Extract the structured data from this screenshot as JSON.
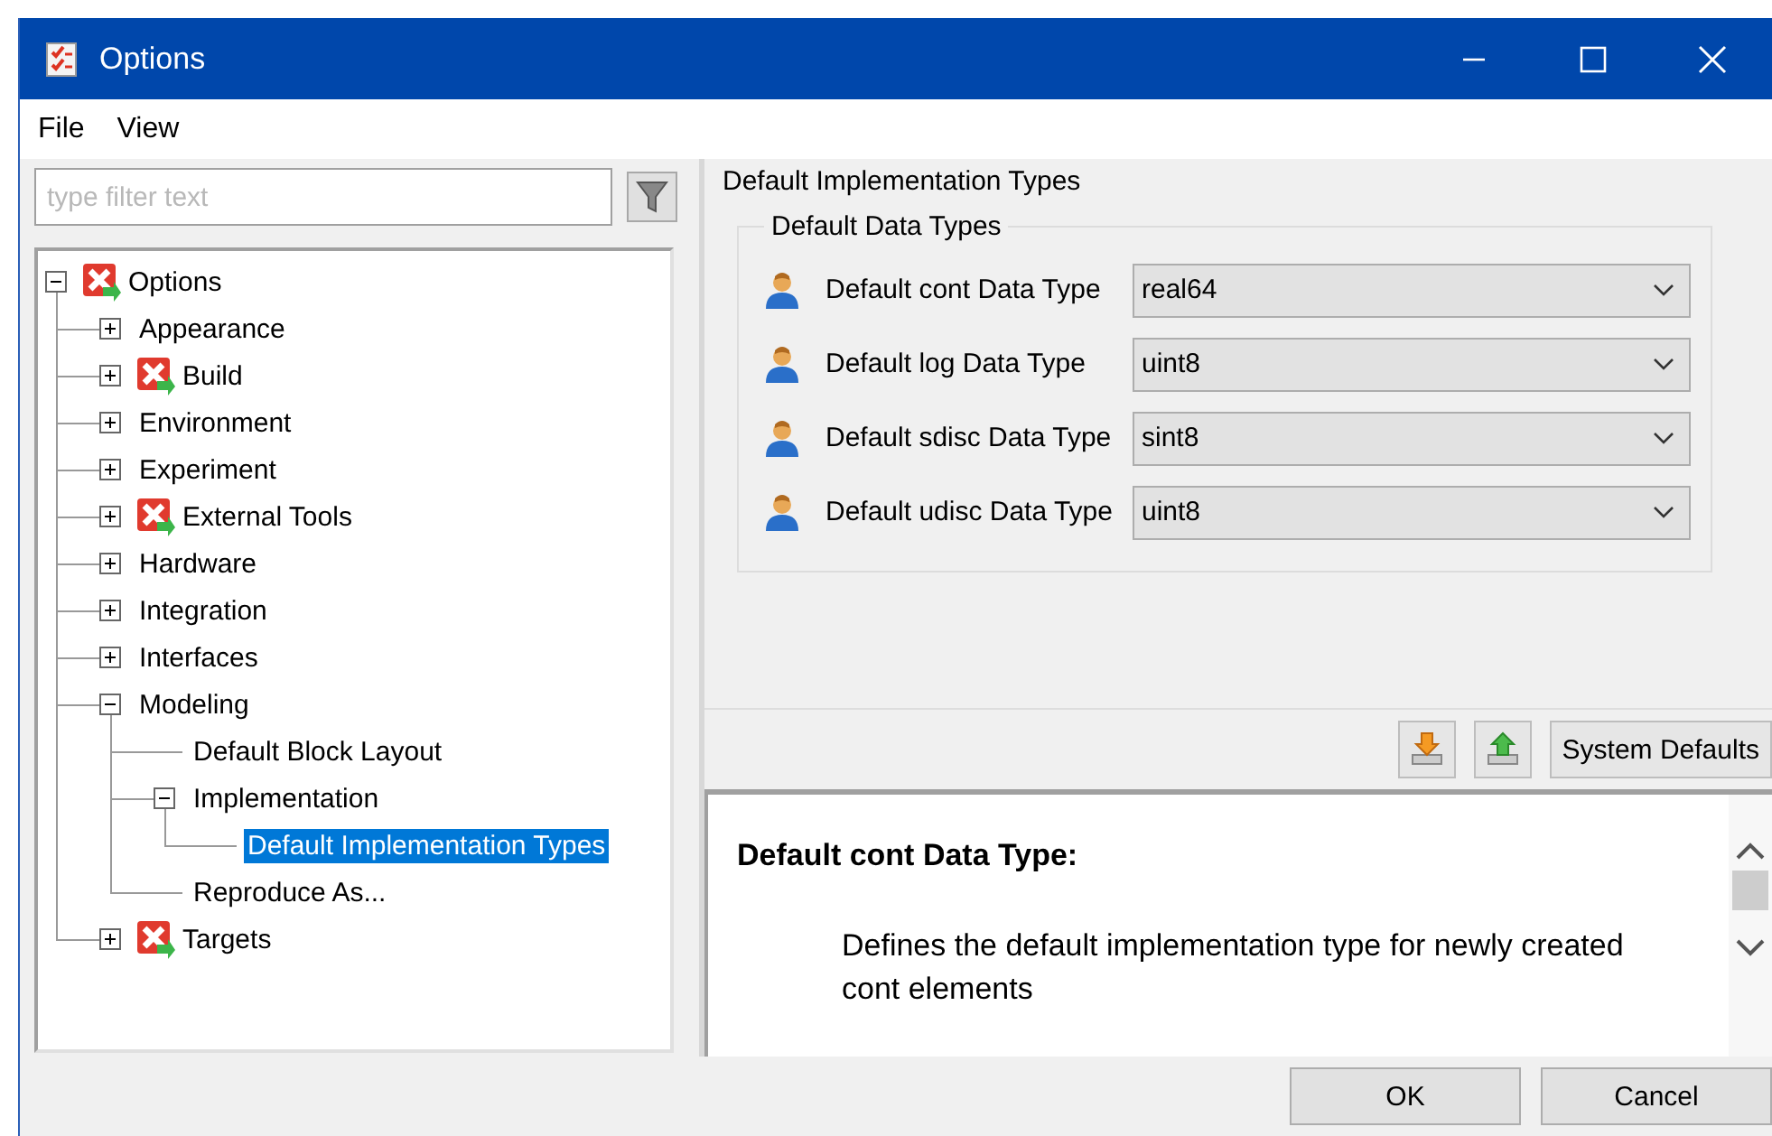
{
  "window": {
    "title": "Options"
  },
  "menu": [
    {
      "label": "File"
    },
    {
      "label": "View"
    }
  ],
  "filter": {
    "placeholder": "type filter text"
  },
  "tree": [
    {
      "label": "Options",
      "marked": true,
      "expanded": true,
      "selected": false,
      "children": [
        {
          "label": "Appearance",
          "marked": false,
          "expanded": false,
          "selected": false
        },
        {
          "label": "Build",
          "marked": true,
          "expanded": false,
          "selected": false
        },
        {
          "label": "Environment",
          "marked": false,
          "expanded": false,
          "selected": false
        },
        {
          "label": "Experiment",
          "marked": false,
          "expanded": false,
          "selected": false
        },
        {
          "label": "External Tools",
          "marked": true,
          "expanded": false,
          "selected": false
        },
        {
          "label": "Hardware",
          "marked": false,
          "expanded": false,
          "selected": false
        },
        {
          "label": "Integration",
          "marked": false,
          "expanded": false,
          "selected": false
        },
        {
          "label": "Interfaces",
          "marked": false,
          "expanded": false,
          "selected": false
        },
        {
          "label": "Modeling",
          "marked": false,
          "expanded": true,
          "selected": false,
          "children": [
            {
              "label": "Default Block Layout",
              "marked": false,
              "selected": false
            },
            {
              "label": "Implementation",
              "marked": false,
              "expanded": true,
              "selected": false,
              "children": [
                {
                  "label": "Default Implementation Types",
                  "marked": false,
                  "selected": true
                }
              ]
            },
            {
              "label": "Reproduce As...",
              "marked": false,
              "selected": false
            }
          ]
        },
        {
          "label": "Targets",
          "marked": true,
          "expanded": false,
          "selected": false
        }
      ]
    }
  ],
  "panel": {
    "title": "Default Implementation Types",
    "group": {
      "title": "Default Data Types",
      "rows": [
        {
          "label": "Default cont Data Type",
          "value": "real64"
        },
        {
          "label": "Default log Data Type",
          "value": "uint8"
        },
        {
          "label": "Default sdisc Data Type",
          "value": "sint8"
        },
        {
          "label": "Default udisc Data Type",
          "value": "uint8"
        }
      ]
    }
  },
  "toolbar": {
    "button": "System Defaults"
  },
  "help": {
    "title": "Default cont Data Type:",
    "text": "Defines the default implementation type for newly created cont elements"
  },
  "buttons": [
    "OK",
    "Cancel"
  ]
}
